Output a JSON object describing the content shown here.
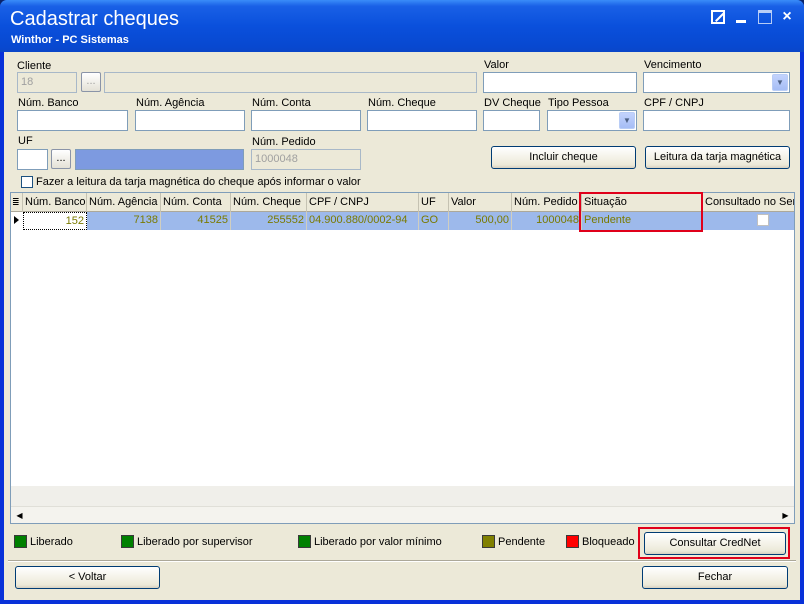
{
  "window": {
    "title": "Cadastrar cheques",
    "subtitle": "Winthor - PC Sistemas",
    "close_glyph": "×"
  },
  "form": {
    "cliente_label": "Cliente",
    "cliente_code": "18",
    "valor_label": "Valor",
    "vencimento_label": "Vencimento",
    "num_banco_label": "Núm. Banco",
    "num_agencia_label": "Núm. Agência",
    "num_conta_label": "Núm. Conta",
    "num_cheque_label": "Núm. Cheque",
    "dv_cheque_label": "DV Cheque",
    "tipo_pessoa_label": "Tipo Pessoa",
    "cpf_cnpj_label": "CPF / CNPJ",
    "uf_label": "UF",
    "num_pedido_label": "Núm. Pedido",
    "num_pedido_value": "1000048",
    "ellipsis": "...",
    "incluir_cheque": "Incluir cheque",
    "leitura_tarja": "Leitura da tarja magnética",
    "checkbox_label": "Fazer a leitura da tarja magnética do cheque após informar o valor"
  },
  "grid": {
    "columns": [
      "Núm. Banco",
      "Núm. Agência",
      "Núm. Conta",
      "Núm. Cheque",
      "CPF / CNPJ",
      "UF",
      "Valor",
      "Núm. Pedido",
      "Situação",
      "Consultado no Ser..."
    ],
    "rows": [
      {
        "num_banco": "152",
        "num_agencia": "7138",
        "num_conta": "41525",
        "num_cheque": "255552",
        "cpf_cnpj": "04.900.880/0002-94",
        "uf": "GO",
        "valor": "500,00",
        "num_pedido": "1000048",
        "situacao": "Pendente",
        "consultado": false
      }
    ]
  },
  "legend": {
    "items": [
      {
        "label": "Liberado",
        "color": "#008000"
      },
      {
        "label": "Liberado por supervisor",
        "color": "#008000"
      },
      {
        "label": "Liberado por valor mínimo",
        "color": "#008000"
      },
      {
        "label": "Pendente",
        "color": "#808000"
      },
      {
        "label": "Bloqueado",
        "color": "#ff0000"
      }
    ]
  },
  "buttons": {
    "consultar_crednet": "Consultar CredNet",
    "voltar": "< Voltar",
    "fechar": "Fechar"
  },
  "colors": {
    "highlight": "#e0001a",
    "selected_row": "#9db9eb"
  }
}
